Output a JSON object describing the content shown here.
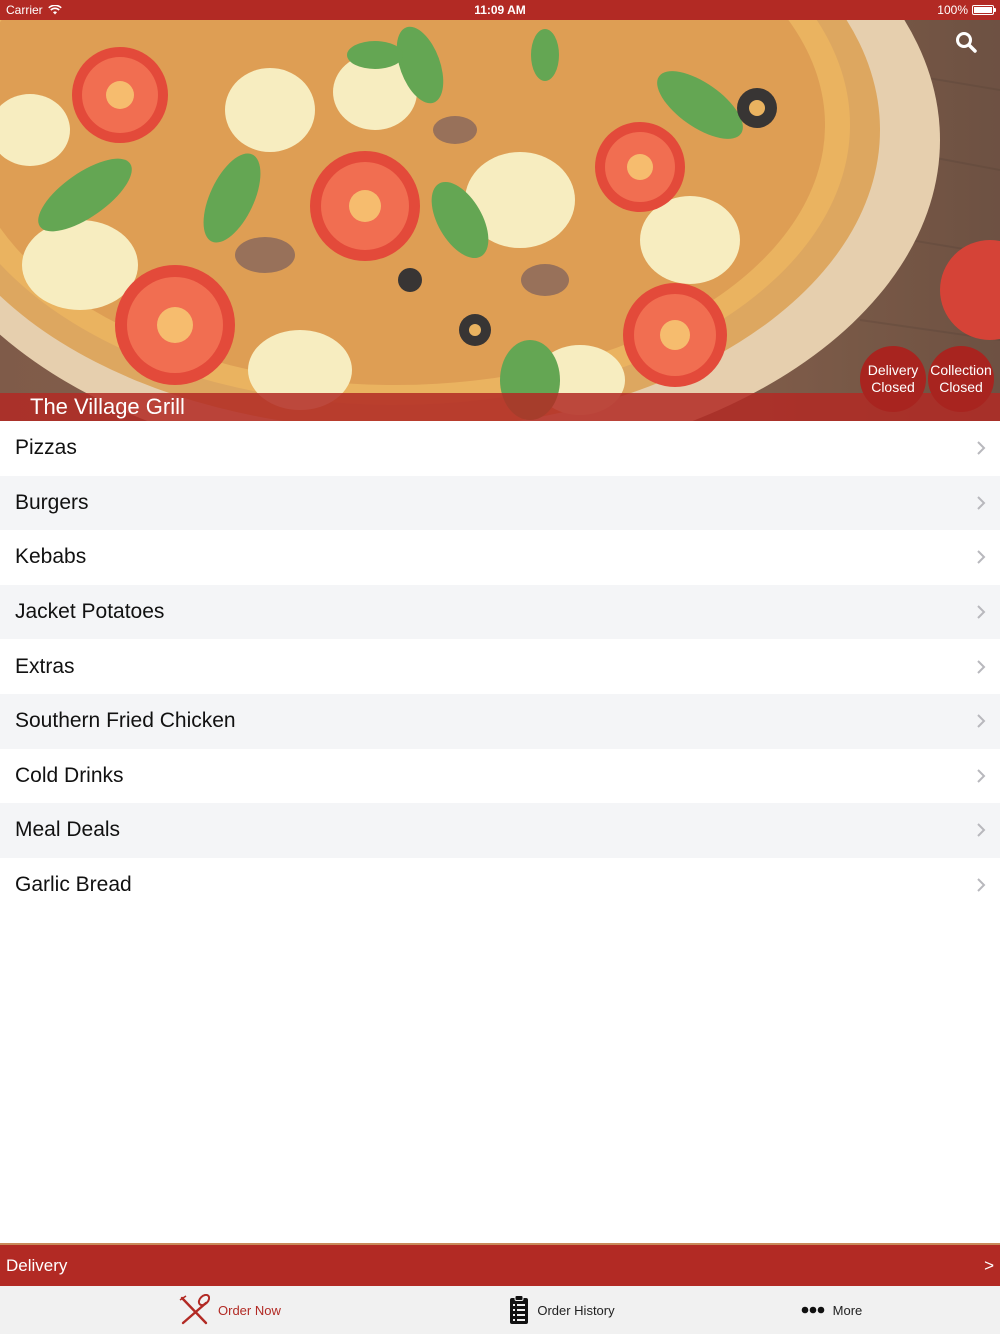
{
  "status_bar": {
    "carrier": "Carrier",
    "time": "11:09 AM",
    "battery": "100%"
  },
  "hero": {
    "restaurant_name": "The Village Grill",
    "delivery_status": {
      "line1": "Delivery",
      "line2": "Closed"
    },
    "collection_status": {
      "line1": "Collection",
      "line2": "Closed"
    }
  },
  "menu": {
    "categories": [
      {
        "label": "Pizzas"
      },
      {
        "label": "Burgers"
      },
      {
        "label": "Kebabs"
      },
      {
        "label": "Jacket Potatoes"
      },
      {
        "label": "Extras"
      },
      {
        "label": "Southern Fried Chicken"
      },
      {
        "label": "Cold Drinks"
      },
      {
        "label": "Meal Deals"
      },
      {
        "label": "Garlic Bread"
      }
    ]
  },
  "delivery_bar": {
    "label": "Delivery",
    "arrow": ">"
  },
  "tabs": [
    {
      "label": "Order Now",
      "icon": "cutlery-icon"
    },
    {
      "label": "Order History",
      "icon": "clipboard-icon"
    },
    {
      "label": "More",
      "icon": "more-icon"
    }
  ],
  "colors": {
    "brand_red": "#b22a24",
    "row_alt": "#f4f5f7"
  }
}
